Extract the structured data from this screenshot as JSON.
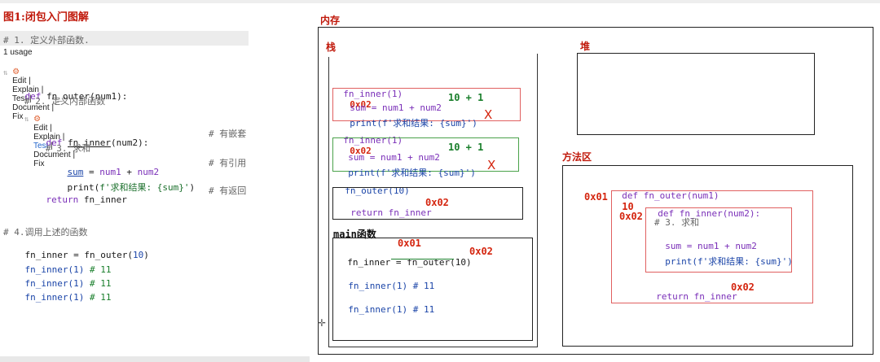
{
  "figure_title": "图1:闭包入门图解",
  "editor": {
    "comment1": "# 1. 定义外部函数.",
    "usage": "1 usage",
    "lens1": [
      "Edit",
      "Explain",
      "Test",
      "Document",
      "Fix"
    ],
    "def_outer": {
      "kw": "def",
      "name": "fn_outer",
      "param": "num1"
    },
    "comment2": "# 2. 定义内部函数",
    "lens2": [
      "Edit",
      "Explain",
      "Test",
      "Document",
      "Fix"
    ],
    "def_inner": {
      "kw": "def",
      "name": "fn_inner",
      "param": "num2"
    },
    "note_nested": "# 有嵌套",
    "comment3": "# 3. 求和",
    "sum_line": {
      "var": "sum",
      "expr1": "num1",
      "op": "+",
      "expr2": "num2"
    },
    "note_ref": "# 有引用",
    "print_line": {
      "fn": "print",
      "str": "f'求和结果: {sum}'"
    },
    "return_line": {
      "kw": "return",
      "val": "fn_inner"
    },
    "note_return": "# 有返回",
    "comment4": "# 4.调用上述的函数",
    "assign_line": {
      "var": "fn_inner",
      "call": "fn_outer",
      "arg": "10"
    },
    "calls": [
      {
        "call": "fn_inner(1)",
        "comment": "# 11"
      },
      {
        "call": "fn_inner(1)",
        "comment": "# 11"
      },
      {
        "call": "fn_inner(1)",
        "comment": "# 11"
      }
    ]
  },
  "memory": {
    "title": "内存",
    "stack": {
      "title": "栈",
      "frame1": {
        "label": "fn_inner(1)",
        "addr": "0x02",
        "sum": "sum = num1 + num2",
        "calc": "10 + 1",
        "print": "print(f'求和结果: {sum}')",
        "x": "X"
      },
      "frame2": {
        "label": "fn_inner(1)",
        "addr": "0x02",
        "sum": "sum = num1 + num2",
        "calc": "10 + 1",
        "print": "print(f'求和结果: {sum}')",
        "x": "X"
      },
      "frame3": {
        "label": "fn_outer(10)",
        "ret": "return fn_inner",
        "addr": "0x02"
      },
      "main": {
        "label": "main函数",
        "addr_top": "0x01",
        "assign": "fn_inner = fn_outer(10)",
        "addr": "0x02",
        "calls": [
          "fn_inner(1) # 11",
          "fn_inner(1) # 11"
        ]
      }
    },
    "heap": {
      "title": "堆"
    },
    "method_area": {
      "title": "方法区",
      "def_outer": "def fn_outer(num1)",
      "outer_val": "10",
      "addr1": "0x01",
      "def_inner": "def fn_inner(num2):",
      "addr2": "0x02",
      "comment": "# 3. 求和",
      "sum": "sum = num1 + num2",
      "print": "print(f'求和结果: {sum}')",
      "ret": "return fn_inner",
      "ret_addr": "0x02"
    }
  },
  "colors": {
    "red": "#d4250f",
    "green": "#1a7f2c",
    "purple": "#7a2fb8",
    "blue": "#1b45a8"
  }
}
